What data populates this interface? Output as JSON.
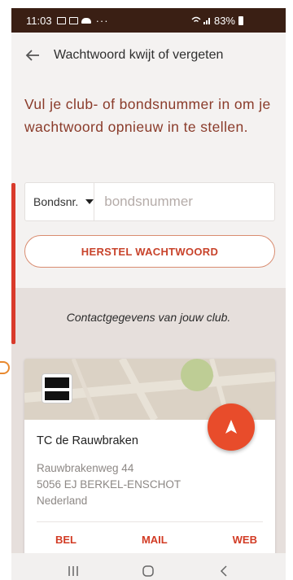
{
  "status": {
    "time": "11:03",
    "dots": "···",
    "battery": "83%"
  },
  "appbar": {
    "title": "Wachtwoord kwijt of vergeten"
  },
  "intro": "Vul je club- of bondsnummer in om je wachtwoord opnieuw in te stellen.",
  "form": {
    "select_value": "Bondsnr.",
    "input_placeholder": "bondsnummer",
    "input_value": "",
    "reset_label": "HERSTEL WACHTWOORD"
  },
  "club": {
    "heading": "Contactgegevens van jouw club.",
    "name": "TC de Rauwbraken",
    "address_line1": "Rauwbrakenweg 44",
    "address_line2": "5056 EJ BERKEL-ENSCHOT",
    "address_line3": "Nederland",
    "actions": [
      "BEL",
      "MAIL",
      "WEB"
    ]
  },
  "colors": {
    "accent": "#e84c2b",
    "status_bar": "#3a1f14",
    "intro_text": "#8a3b2a"
  },
  "icons": {
    "back": "arrow-left-icon",
    "navigate": "navigation-arrow-icon",
    "recents": "recents-icon",
    "home": "home-icon",
    "back_nav": "chevron-left-icon"
  }
}
